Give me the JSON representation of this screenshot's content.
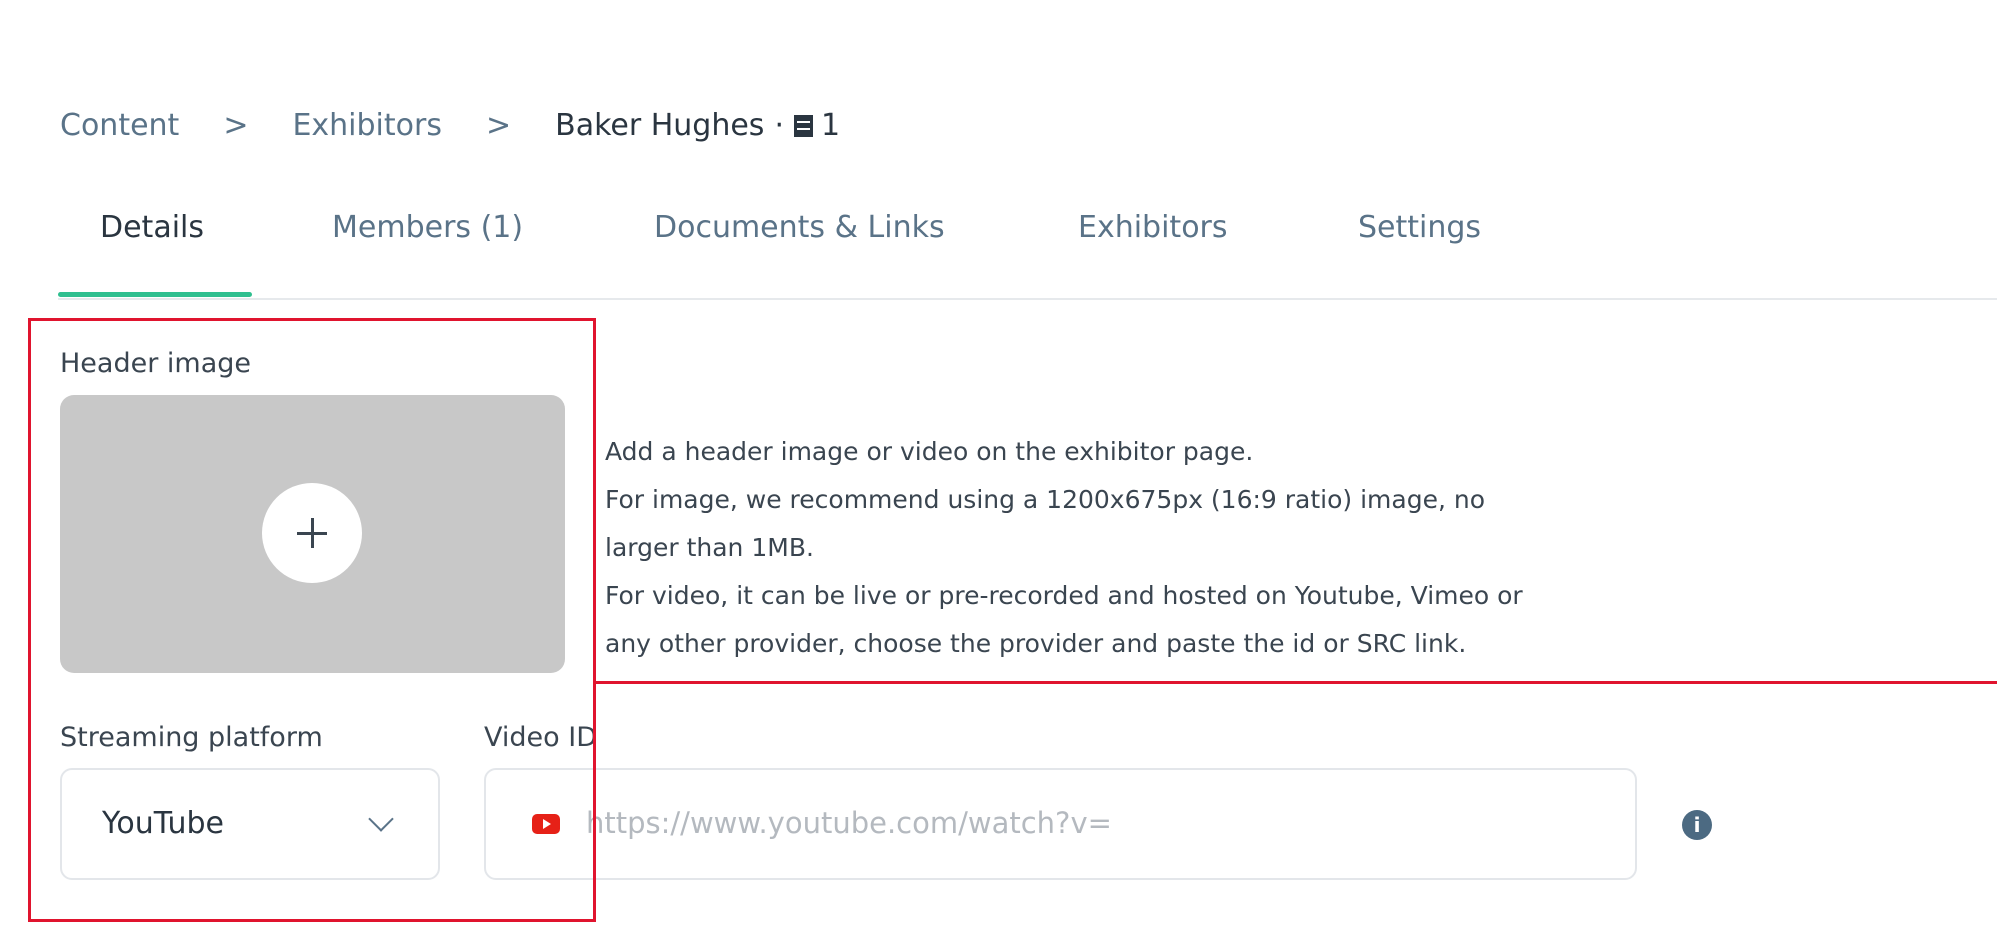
{
  "breadcrumb": {
    "items": [
      "Content",
      "Exhibitors"
    ],
    "separator": ">",
    "current": "Baker Hughes",
    "dot": "·",
    "doc_icon": "document-icon",
    "count": "1"
  },
  "tabs": {
    "items": [
      {
        "label": "Details",
        "active": true
      },
      {
        "label": "Members (1)",
        "active": false
      },
      {
        "label": "Documents & Links",
        "active": false
      },
      {
        "label": "Exhibitors",
        "active": false
      },
      {
        "label": "Settings",
        "active": false
      }
    ],
    "active_underline_color": "#2fbf8f"
  },
  "header_image": {
    "label": "Header image",
    "upload_icon": "plus-icon",
    "help_lines": [
      "Add a header image or video on the exhibitor page.",
      "For image, we recommend using a 1200x675px (16:9 ratio) image, no",
      "larger than 1MB.",
      "For video, it can be live or pre-recorded and hosted on Youtube, Vimeo or",
      "any other provider, choose the provider and paste the id or SRC link."
    ]
  },
  "streaming": {
    "label": "Streaming platform",
    "selected": "YouTube",
    "icon": "chevron-down-icon"
  },
  "video": {
    "label": "Video ID",
    "placeholder": "https://www.youtube.com/watch?v=",
    "provider_icon": "youtube-icon",
    "info_icon": "info-icon",
    "info_glyph": "i"
  },
  "annotation_color": "#e0142e"
}
